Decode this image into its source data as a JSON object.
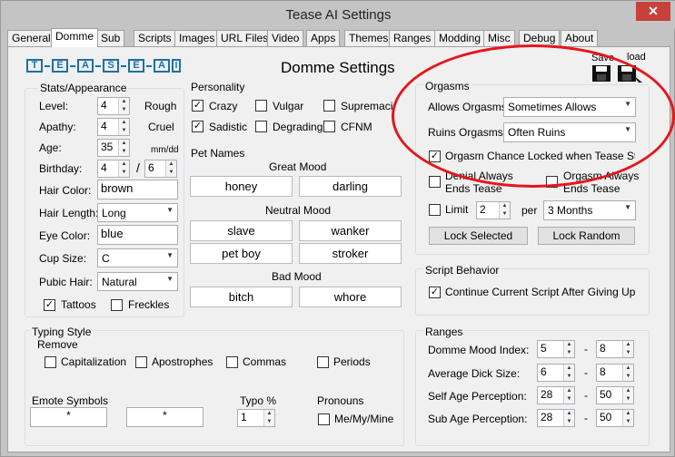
{
  "window": {
    "title": "Tease AI Settings",
    "close": "✕"
  },
  "tabs": [
    "General",
    "Domme",
    "Sub",
    "Scripts",
    "Images",
    "URL Files",
    "Video",
    "Apps",
    "Themes",
    "Ranges",
    "Modding",
    "Misc",
    "Debug",
    "About"
  ],
  "active_tab": "Domme",
  "header": {
    "logo_letters": [
      "T",
      "E",
      "A",
      "S",
      "E",
      "A",
      "I"
    ],
    "heading": "Domme Settings",
    "save_label": "Save",
    "load_label": "load"
  },
  "stats": {
    "group_label": "Stats/Appearance",
    "level_label": "Level:",
    "level": "4",
    "level_desc": "Rough",
    "apathy_label": "Apathy:",
    "apathy": "4",
    "apathy_desc": "Cruel",
    "age_label": "Age:",
    "age": "35",
    "mmdd": "mm/dd",
    "birthday_label": "Birthday:",
    "birthday_month": "4",
    "slash": "/",
    "birthday_day": "6",
    "hair_color_label": "Hair Color:",
    "hair_color": "brown",
    "hair_length_label": "Hair Length:",
    "hair_length": "Long",
    "eye_color_label": "Eye Color:",
    "eye_color": "blue",
    "cup_size_label": "Cup Size:",
    "cup_size": "C",
    "pubic_hair_label": "Pubic Hair:",
    "pubic_hair": "Natural",
    "tattoos_label": "Tattoos",
    "tattoos": true,
    "freckles_label": "Freckles",
    "freckles": false
  },
  "personality": {
    "group_label": "Personality",
    "items": [
      {
        "label": "Crazy",
        "checked": true
      },
      {
        "label": "Vulgar",
        "checked": false
      },
      {
        "label": "Supremacist",
        "checked": false
      },
      {
        "label": "Sadistic",
        "checked": true
      },
      {
        "label": "Degrading",
        "checked": false
      },
      {
        "label": "CFNM",
        "checked": false
      }
    ]
  },
  "pet_names": {
    "group_label": "Pet Names",
    "great_label": "Great Mood",
    "great": [
      "honey",
      "darling"
    ],
    "neutral_label": "Neutral Mood",
    "neutral": [
      "slave",
      "wanker",
      "pet boy",
      "stroker"
    ],
    "bad_label": "Bad Mood",
    "bad": [
      "bitch",
      "whore"
    ]
  },
  "orgasms": {
    "group_label": "Orgasms",
    "allows_label": "Allows Orgasms:",
    "allows": "Sometimes Allows",
    "ruins_label": "Ruins Orgasms:",
    "ruins": "Often Ruins",
    "chance_locked_label": "Orgasm Chance Locked when Tease Starts",
    "chance_locked": true,
    "denial_label_1": "Denial Always",
    "denial_label_2": "Ends Tease",
    "denial": false,
    "orgasm_always_1": "Orgasm Always",
    "orgasm_always_2": "Ends Tease",
    "orgasm_always": false,
    "limit_label": "Limit",
    "limit": false,
    "limit_value": "2",
    "per_label": "per",
    "per_value": "3 Months",
    "lock_selected": "Lock Selected",
    "lock_random": "Lock Random"
  },
  "script_behavior": {
    "group_label": "Script Behavior",
    "continue_label": "Continue Current Script After Giving Up",
    "continue": true
  },
  "typing": {
    "group_label": "Typing Style",
    "remove_label": "Remove",
    "items": [
      {
        "label": "Capitalization",
        "checked": false
      },
      {
        "label": "Apostrophes",
        "checked": false
      },
      {
        "label": "Commas",
        "checked": false
      },
      {
        "label": "Periods",
        "checked": false
      }
    ],
    "emote_label": "Emote Symbols",
    "emote_left": "*",
    "emote_right": "*",
    "typo_label": "Typo %",
    "typo": "1",
    "pronouns_label": "Pronouns",
    "pronouns_option": "Me/My/Mine",
    "pronouns_checked": false
  },
  "ranges": {
    "group_label": "Ranges",
    "rows": [
      {
        "label": "Domme Mood Index:",
        "min": "5",
        "max": "8"
      },
      {
        "label": "Average Dick Size:",
        "min": "6",
        "max": "8"
      },
      {
        "label": "Self Age Perception:",
        "min": "28",
        "max": "50"
      },
      {
        "label": "Sub Age Perception:",
        "min": "28",
        "max": "50"
      }
    ],
    "dash": "-"
  },
  "colors": {
    "annotation_red": "#e5161b",
    "panel_bg": "#f0f0f0",
    "check": "#000000"
  }
}
